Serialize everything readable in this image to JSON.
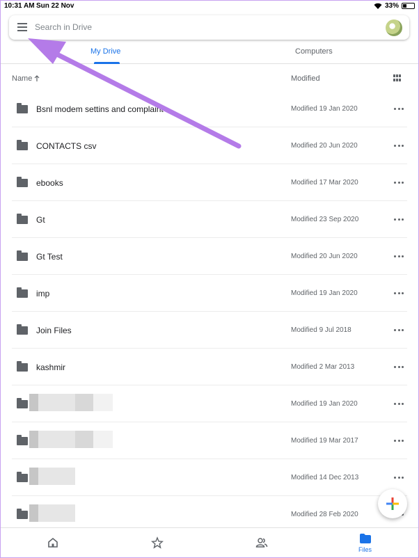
{
  "status_bar": {
    "time": "10:31 AM",
    "date": "Sun 22 Nov",
    "battery": "33%"
  },
  "search": {
    "placeholder": "Search in Drive"
  },
  "tabs": [
    {
      "label": "My Drive",
      "active": true
    },
    {
      "label": "Computers",
      "active": false
    }
  ],
  "list_header": {
    "name": "Name",
    "sort_icon": "arrow-up-icon",
    "modified": "Modified",
    "view_icon": "grid-view-icon"
  },
  "files": [
    {
      "name": "Bsnl modem settins and complaint",
      "modified": "Modified 19 Jan 2020"
    },
    {
      "name": "CONTACTS csv",
      "modified": "Modified 20 Jun 2020"
    },
    {
      "name": "ebooks",
      "modified": "Modified 17 Mar 2020"
    },
    {
      "name": "Gt",
      "modified": "Modified 23 Sep 2020"
    },
    {
      "name": "Gt Test",
      "modified": "Modified 20 Jun 2020"
    },
    {
      "name": "imp",
      "modified": "Modified 19 Jan 2020"
    },
    {
      "name": "Join Files",
      "modified": "Modified 9 Jul 2018"
    },
    {
      "name": "kashmir",
      "modified": "Modified 2 Mar 2013"
    },
    {
      "name": "",
      "modified": "Modified 19 Jan 2020"
    },
    {
      "name": "",
      "modified": "Modified 19 Mar 2017"
    },
    {
      "name": "",
      "modified": "Modified 14 Dec 2013"
    },
    {
      "name": "",
      "modified": "Modified 28 Feb 2020"
    }
  ],
  "bottom_nav": [
    {
      "icon": "home-icon",
      "label": ""
    },
    {
      "icon": "star-icon",
      "label": ""
    },
    {
      "icon": "shared-people-icon",
      "label": ""
    },
    {
      "icon": "folder-icon",
      "label": "Files",
      "active": true
    }
  ],
  "colors": {
    "accent": "#1a73e8",
    "annotation_arrow": "#b47be8",
    "icon_gray": "#5f6368"
  }
}
